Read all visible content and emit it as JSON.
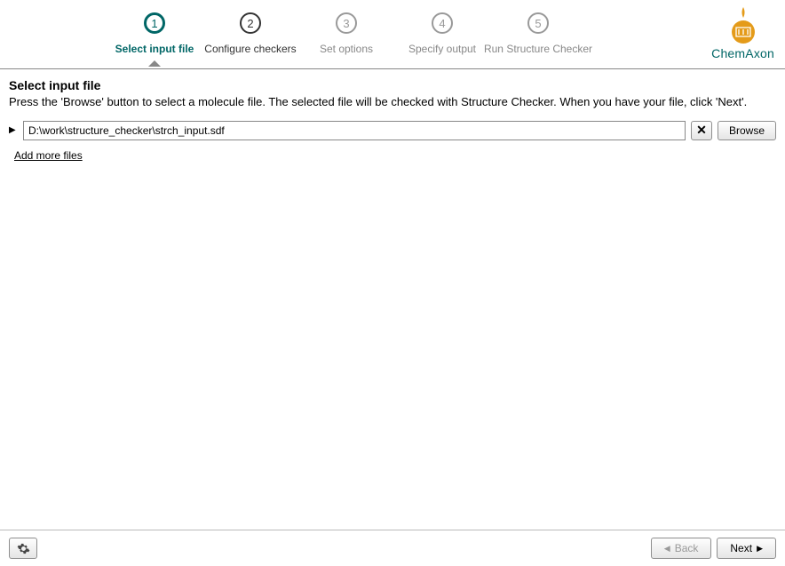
{
  "brand": "ChemAxon",
  "steps": [
    {
      "num": "1",
      "label": "Select input file",
      "state": "active"
    },
    {
      "num": "2",
      "label": "Configure checkers",
      "state": "enabled"
    },
    {
      "num": "3",
      "label": "Set options",
      "state": "disabled"
    },
    {
      "num": "4",
      "label": "Specify output",
      "state": "disabled"
    },
    {
      "num": "5",
      "label": "Run Structure Checker",
      "state": "disabled"
    }
  ],
  "page": {
    "title": "Select input file",
    "description": "Press the 'Browse' button to select a molecule file. The selected file will be checked with Structure Checker. When you have your file, click 'Next'."
  },
  "file": {
    "path": "D:\\work\\structure_checker\\strch_input.sdf",
    "browse_label": "Browse",
    "add_more_label": "Add more files"
  },
  "footer": {
    "back_label": "Back",
    "next_label": "Next"
  }
}
